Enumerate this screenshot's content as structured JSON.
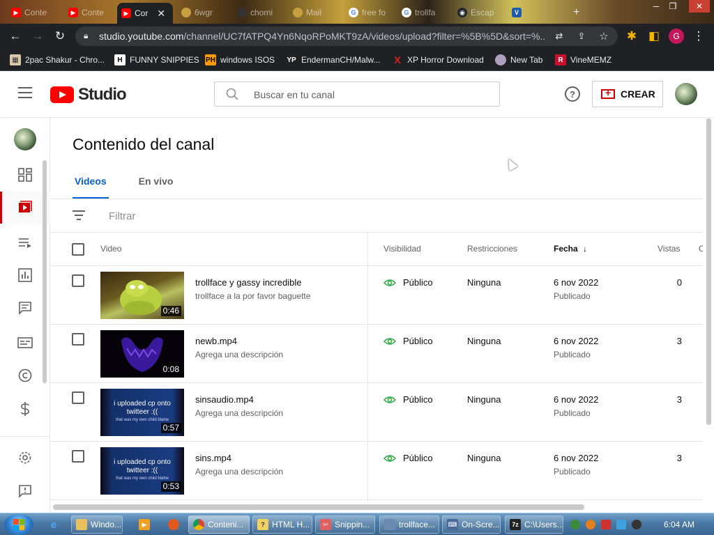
{
  "browser": {
    "tabs": [
      {
        "label": "Conte",
        "icon": "youtube-icon",
        "color": "#ff0000"
      },
      {
        "label": "Conte",
        "icon": "youtube-icon",
        "color": "#ff0000"
      },
      {
        "label": "Cor",
        "icon": "youtube-icon",
        "color": "#ff0000",
        "active": true
      },
      {
        "label": "6wgr",
        "icon": "site-icon",
        "color": "#c8a040"
      },
      {
        "label": "chomi",
        "icon": "cloud-icon",
        "color": "#333333"
      },
      {
        "label": "Mail",
        "icon": "site-icon",
        "color": "#c8a040"
      },
      {
        "label": "free fo",
        "icon": "google-icon",
        "color": "#4285f4"
      },
      {
        "label": "trollfa",
        "icon": "google-icon",
        "color": "#4285f4"
      },
      {
        "label": "Escap",
        "icon": "github-icon",
        "color": "#24292e"
      },
      {
        "label": "",
        "icon": "v-icon",
        "color": "#1e5aa8"
      }
    ],
    "new_tab": "+",
    "url_host": "studio.youtube.com",
    "url_path": "/channel/UC7fATPQ4Yn6NqoRPoMKT9zA/videos/upload?filter=%5B%5D&sort=%...",
    "profile_initial": "G",
    "bookmarks": [
      {
        "label": "2pac Shakur - Chro...",
        "icon": "bookmark-icon-1"
      },
      {
        "label": "FUNNY SNIPPIES",
        "icon": "h-icon"
      },
      {
        "label": "windows ISOS",
        "icon": "ph-icon"
      },
      {
        "label": "EndermanCH/Malw...",
        "icon": "yp-icon"
      },
      {
        "label": "XP Horror Download",
        "icon": "x-icon"
      },
      {
        "label": "New Tab",
        "icon": "newtab-icon"
      },
      {
        "label": "VineMEMZ",
        "icon": "r-icon"
      }
    ]
  },
  "studio": {
    "logo_text": "Studio",
    "search_placeholder": "Buscar en tu canal",
    "help_glyph": "?",
    "create_label": "CREAR",
    "page_title": "Contenido del canal",
    "tabs": [
      "Videos",
      "En vivo"
    ],
    "filter_label": "Filtrar",
    "columns": {
      "video": "Video",
      "visibility": "Visibilidad",
      "restrictions": "Restricciones",
      "date": "Fecha",
      "views": "Vistas",
      "comments": "C"
    },
    "sort_indicator": "↓",
    "videos": [
      {
        "title": "trollface y gassy incredible",
        "description": "trollface a la por favor baguette",
        "duration": "0:46",
        "visibility": "Público",
        "restrictions": "Ninguna",
        "date": "6 nov 2022",
        "status": "Publicado",
        "views": "0"
      },
      {
        "title": "newb.mp4",
        "description": "Agrega una descripción",
        "duration": "0:08",
        "visibility": "Público",
        "restrictions": "Ninguna",
        "date": "6 nov 2022",
        "status": "Publicado",
        "views": "3"
      },
      {
        "title": "sinsaudio.mp4",
        "description": "Agrega una descripción",
        "duration": "0:57",
        "visibility": "Público",
        "restrictions": "Ninguna",
        "date": "6 nov 2022",
        "status": "Publicado",
        "views": "3",
        "thumb_text": "i uploaded cp onto twitteer :((",
        "thumb_subtext": "that was my own child blahw"
      },
      {
        "title": "sins.mp4",
        "description": "Agrega una descripción",
        "duration": "0:53",
        "visibility": "Público",
        "restrictions": "Ninguna",
        "date": "6 nov 2022",
        "status": "Publicado",
        "views": "3",
        "thumb_text": "i uploaded cp onto twitteer :((",
        "thumb_subtext": "that was my own child blahw"
      }
    ]
  },
  "taskbar": {
    "buttons": [
      {
        "label": "Windo...",
        "icon": "explorer-icon"
      },
      {
        "label": "Conteni...",
        "icon": "chrome-icon",
        "active": true
      },
      {
        "label": "HTML H...",
        "icon": "html-icon"
      },
      {
        "label": "Snippin...",
        "icon": "snipping-icon"
      },
      {
        "label": "trollface...",
        "icon": "image-icon"
      },
      {
        "label": "On-Scre...",
        "icon": "keyboard-icon"
      },
      {
        "label": "C:\\Users...",
        "icon": "7zip-icon"
      }
    ],
    "clock": "6:04 AM"
  },
  "colors": {
    "accent": "#065fd4",
    "brand_red": "#ff0000",
    "visibility_green": "#2ba640"
  }
}
